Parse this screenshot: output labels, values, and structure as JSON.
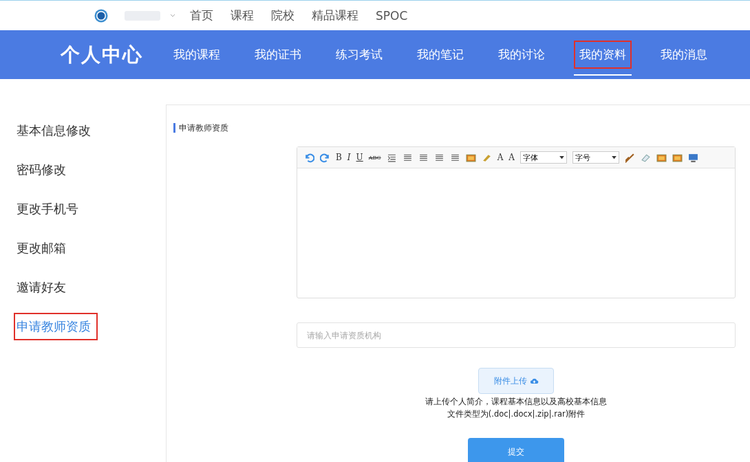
{
  "top_nav": {
    "links": [
      "首页",
      "课程",
      "院校",
      "精品课程",
      "SPOC"
    ]
  },
  "header": {
    "title": "个人中心",
    "tabs": [
      {
        "label": "我的课程",
        "selected": false
      },
      {
        "label": "我的证书",
        "selected": false
      },
      {
        "label": "练习考试",
        "selected": false
      },
      {
        "label": "我的笔记",
        "selected": false
      },
      {
        "label": "我的讨论",
        "selected": false
      },
      {
        "label": "我的资料",
        "selected": true
      },
      {
        "label": "我的消息",
        "selected": false
      }
    ]
  },
  "sidebar": {
    "items": [
      {
        "label": "基本信息修改",
        "selected": false
      },
      {
        "label": "密码修改",
        "selected": false
      },
      {
        "label": "更改手机号",
        "selected": false
      },
      {
        "label": "更改邮箱",
        "selected": false
      },
      {
        "label": "邀请好友",
        "selected": false
      },
      {
        "label": "申请教师资质",
        "selected": true
      }
    ]
  },
  "section_title": "申请教师资质",
  "editor": {
    "toolbar": [
      {
        "kind": "undo"
      },
      {
        "kind": "redo"
      },
      {
        "kind": "style",
        "label": "B"
      },
      {
        "kind": "style",
        "label": "I"
      },
      {
        "kind": "style",
        "label": "U"
      },
      {
        "kind": "style",
        "label": "ABC"
      },
      {
        "kind": "indent"
      },
      {
        "kind": "align"
      },
      {
        "kind": "align"
      },
      {
        "kind": "align"
      },
      {
        "kind": "align"
      },
      {
        "kind": "image"
      },
      {
        "kind": "highlight"
      },
      {
        "kind": "style",
        "label": "A"
      },
      {
        "kind": "style",
        "label": "A"
      },
      {
        "kind": "dropdown",
        "label": "字体"
      },
      {
        "kind": "dropdown",
        "label": "字号"
      },
      {
        "kind": "brush"
      },
      {
        "kind": "eraser"
      },
      {
        "kind": "image"
      },
      {
        "kind": "image"
      },
      {
        "kind": "screen"
      }
    ]
  },
  "institution_field": {
    "placeholder": "请输入申请资质机构"
  },
  "upload_button": "附件上传",
  "upload_hint": [
    "请上传个人简介，课程基本信息以及高校基本信息",
    "文件类型为(.doc|.docx|.zip|.rar)附件"
  ],
  "submit_button": "提交"
}
